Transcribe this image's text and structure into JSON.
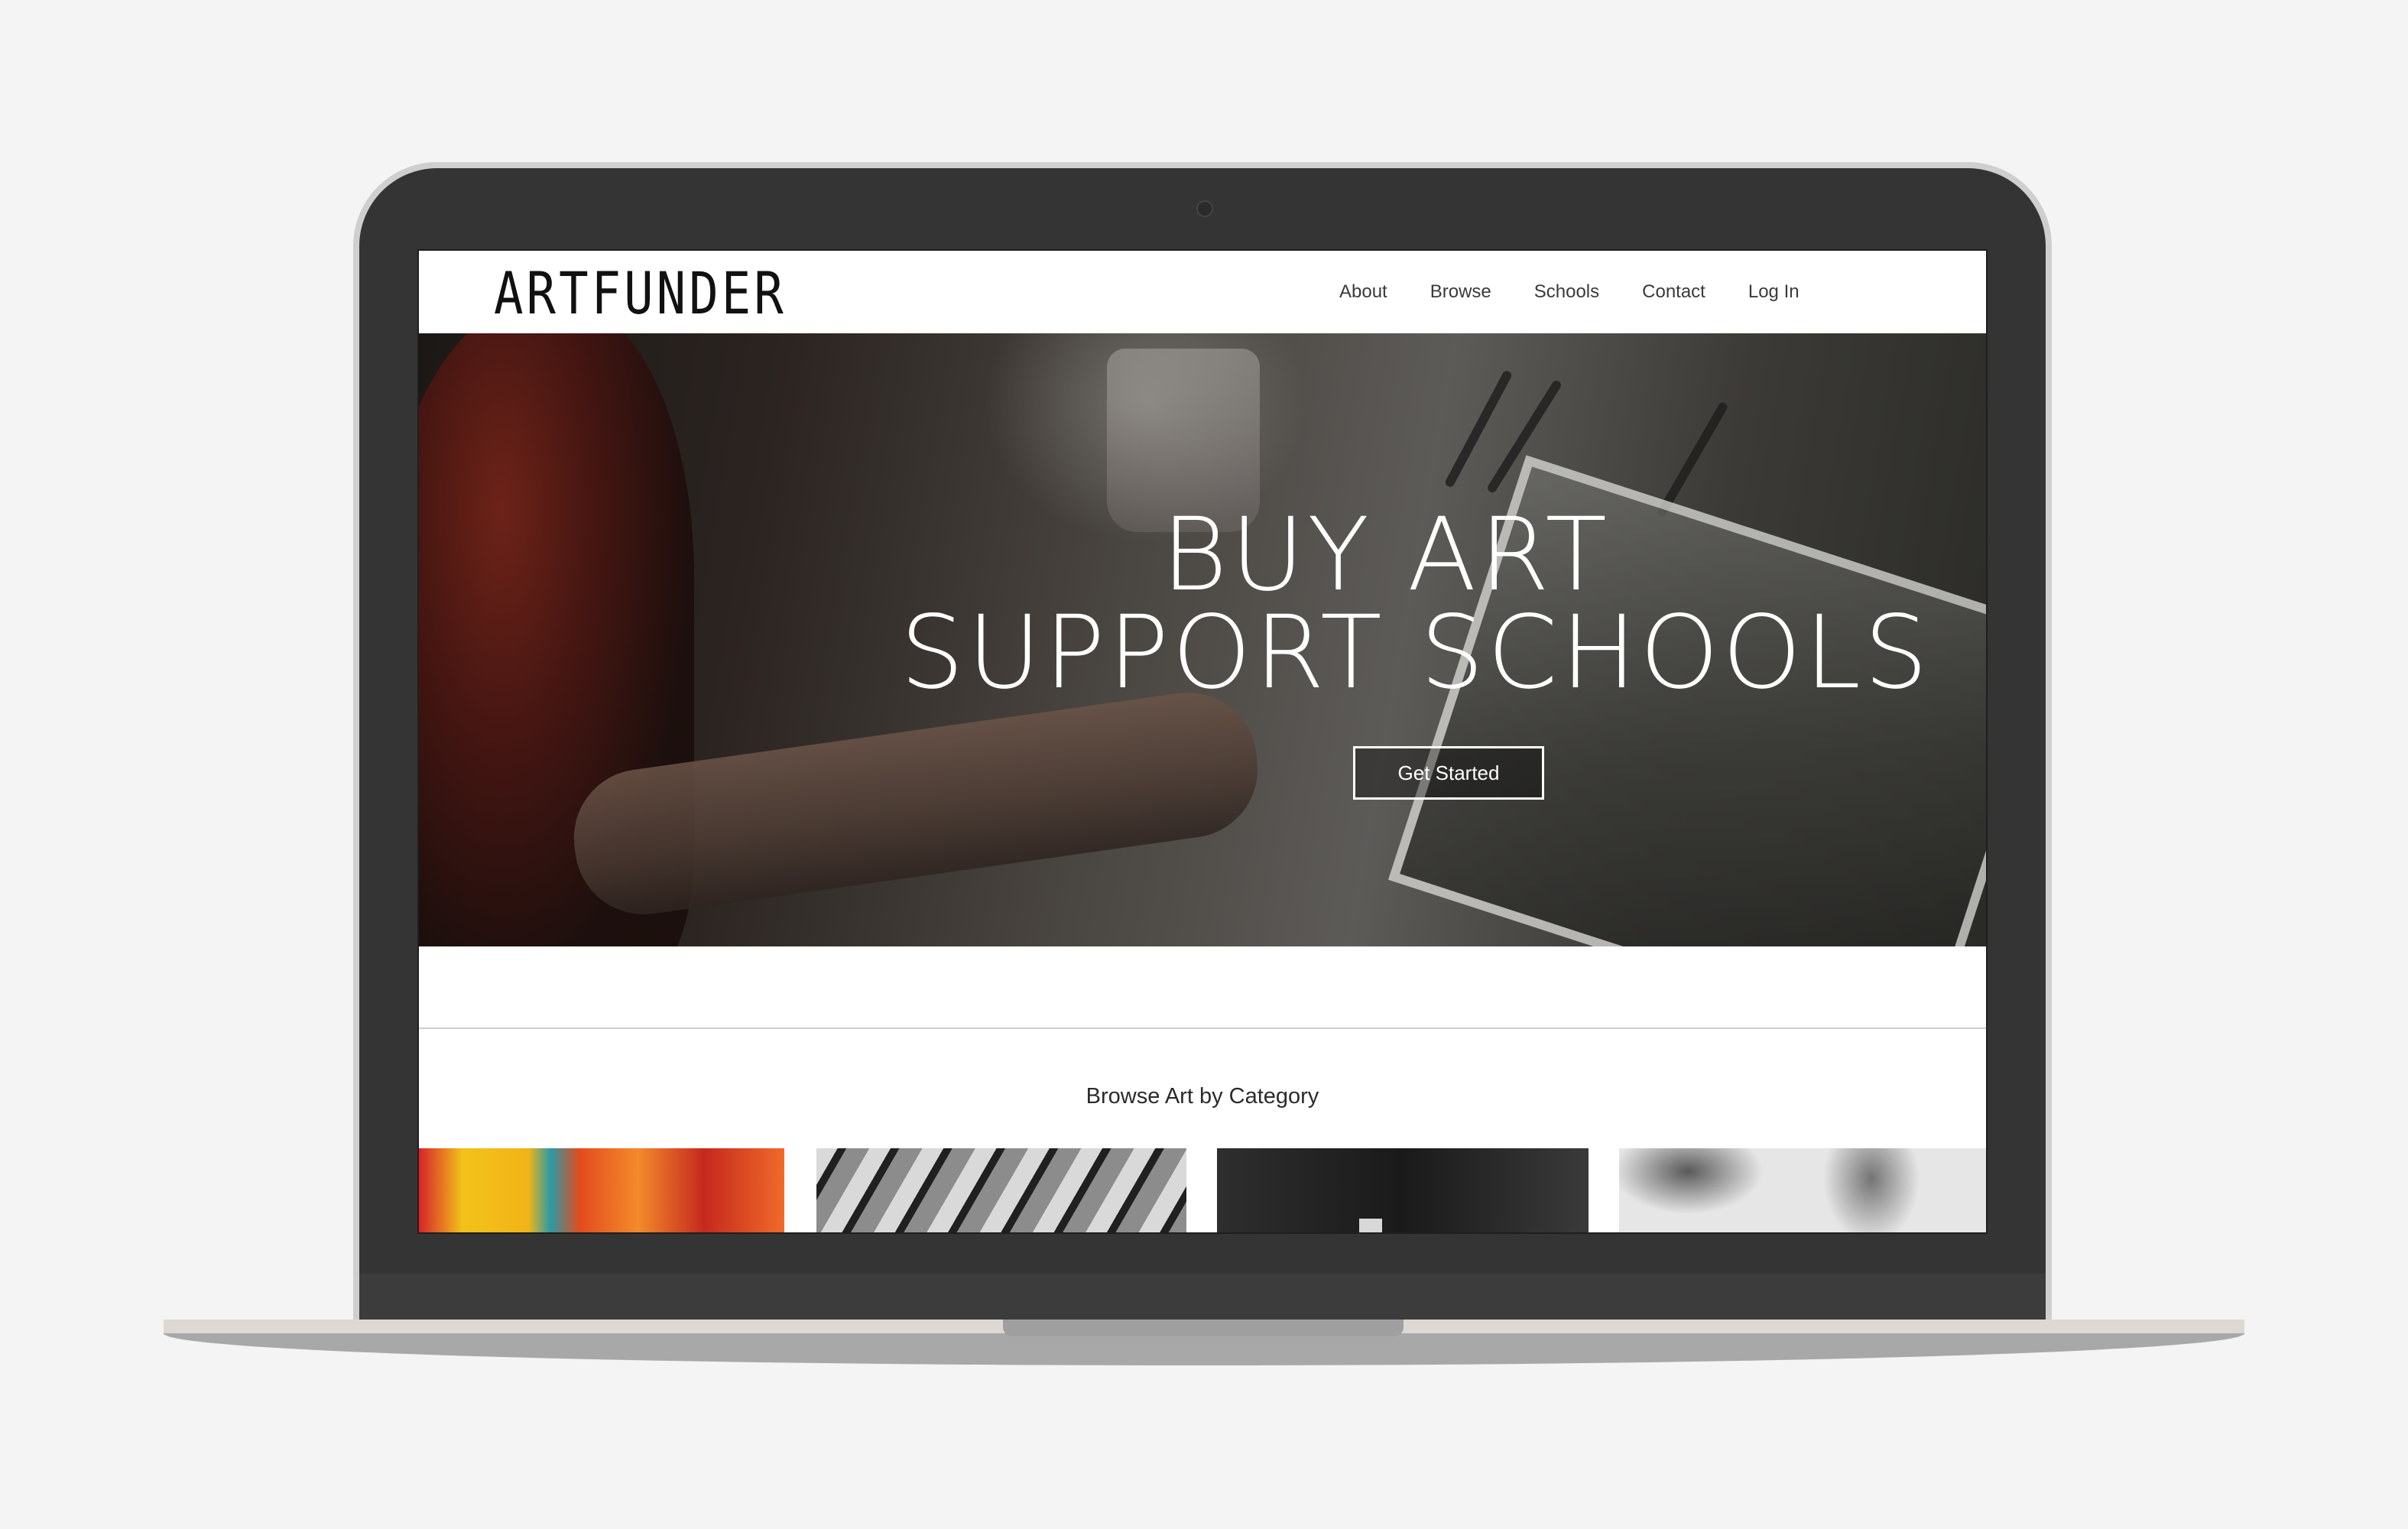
{
  "brand": {
    "logo_text": "ARTFUNDER"
  },
  "nav": {
    "items": [
      {
        "label": "About"
      },
      {
        "label": "Browse"
      },
      {
        "label": "Schools"
      },
      {
        "label": "Contact"
      },
      {
        "label": "Log In"
      }
    ]
  },
  "hero": {
    "title_line1": "BUY ART",
    "title_line2": "SUPPORT SCHOOLS",
    "cta_label": "Get Started"
  },
  "categories": {
    "heading": "Browse Art by Category",
    "tiles": [
      {
        "theme": "colorful-abstract"
      },
      {
        "theme": "black-white-objects"
      },
      {
        "theme": "dark-still"
      },
      {
        "theme": "ink-sketch"
      }
    ]
  },
  "colors": {
    "page_background": "#f4f4f4",
    "laptop_body": "#343434",
    "hero_text": "#ffffff",
    "nav_text": "#3a3a3a"
  }
}
